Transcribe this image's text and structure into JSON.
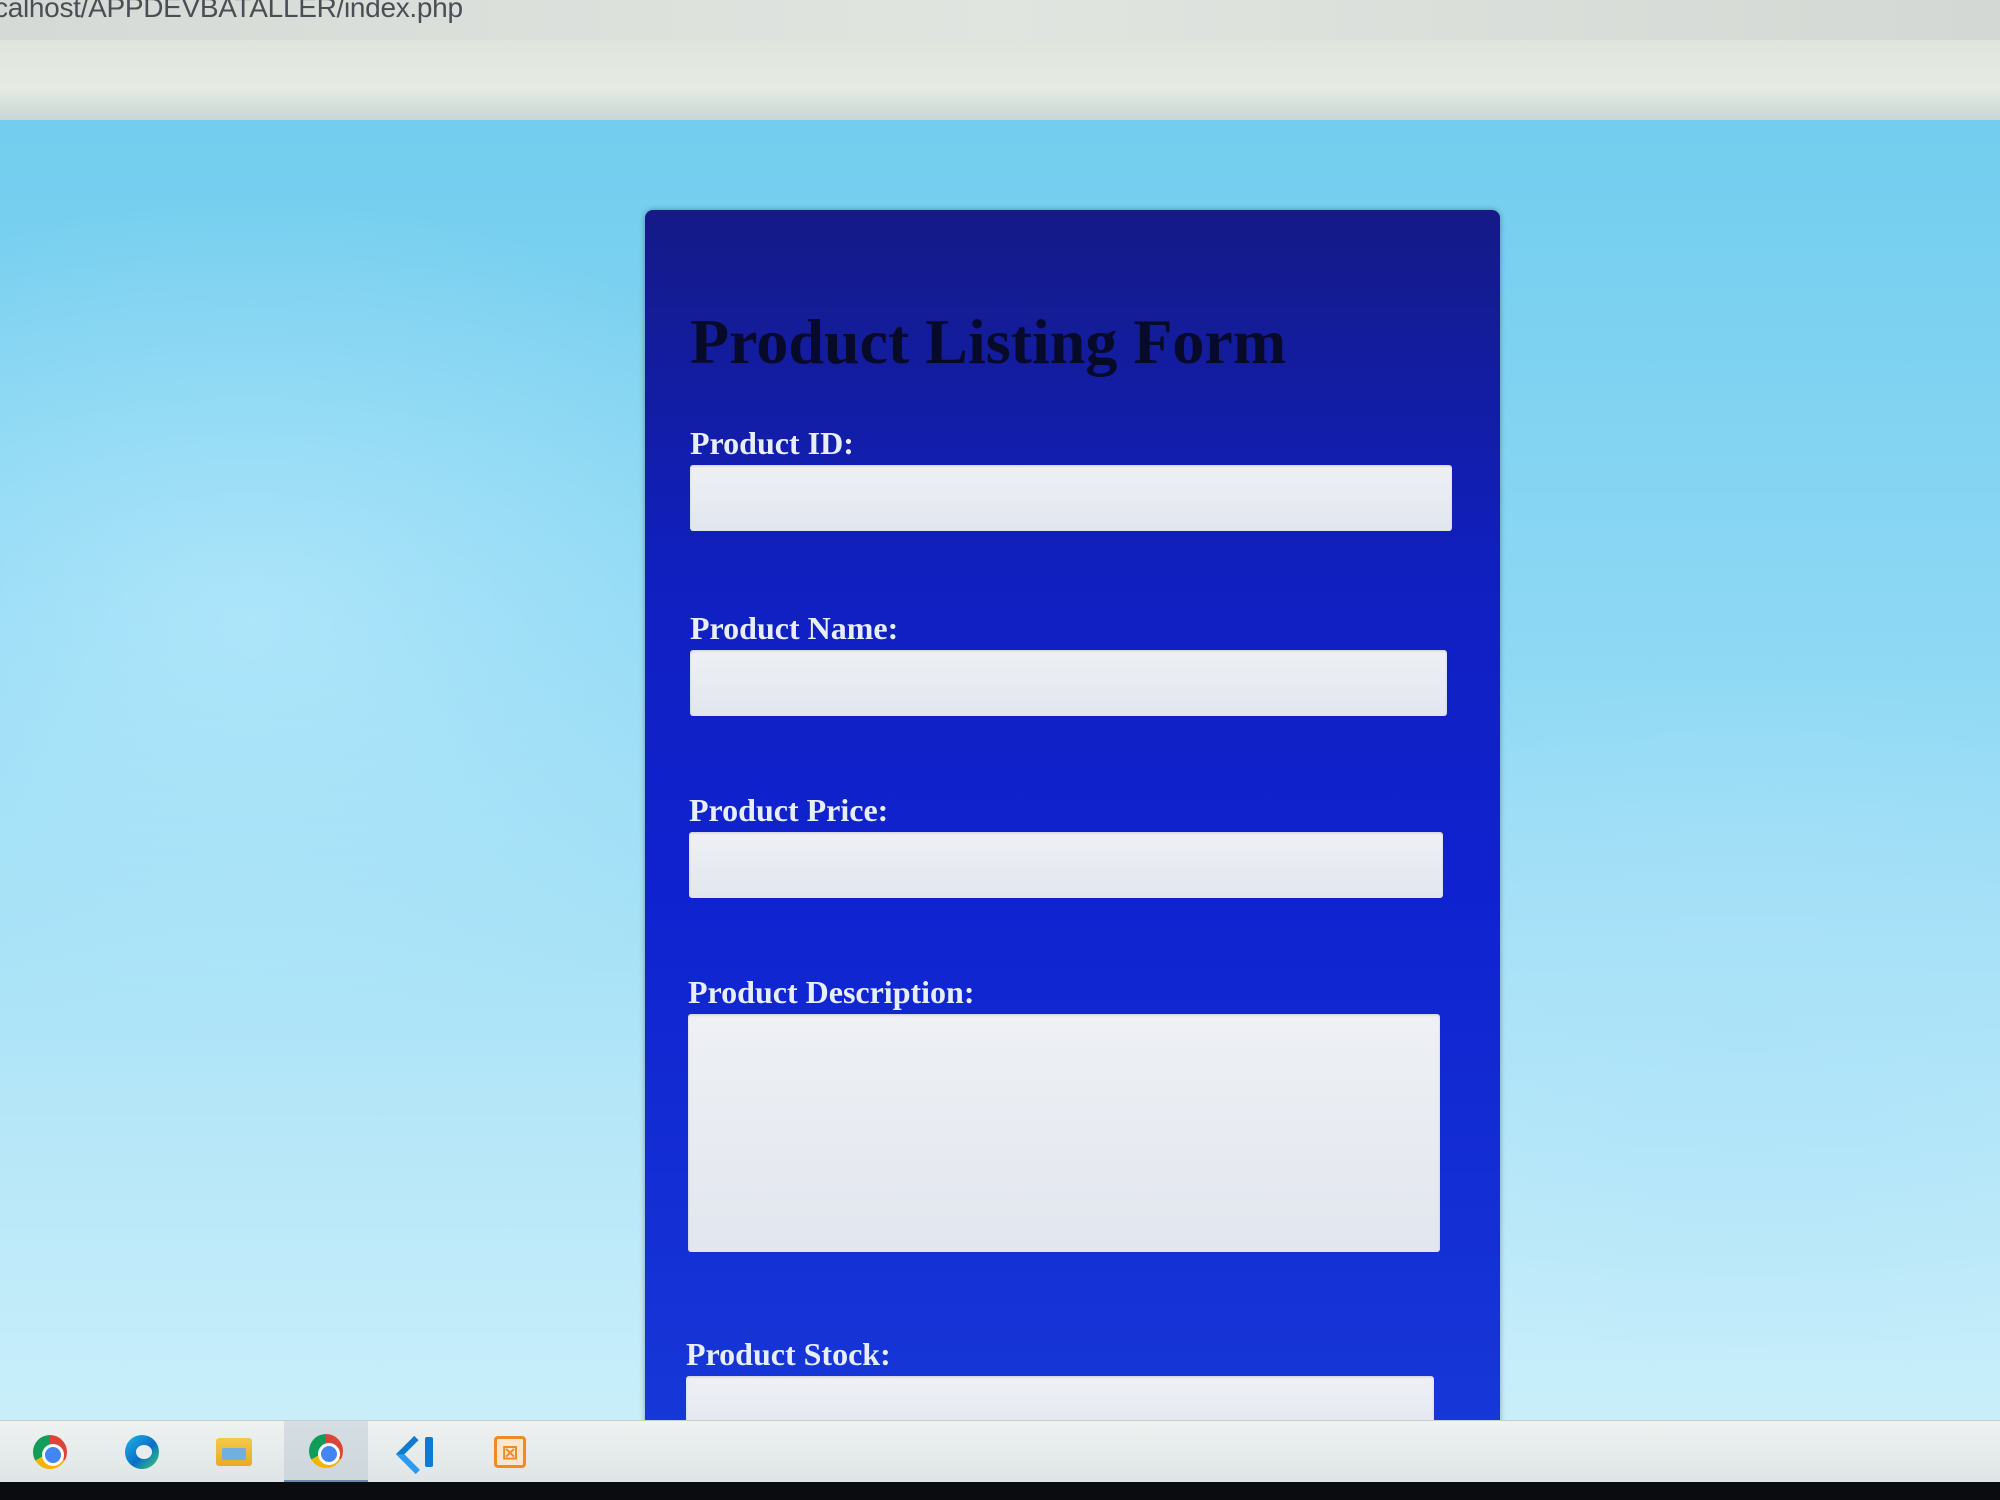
{
  "browser": {
    "url": "calhost/APPDEVBATALLER/index.php"
  },
  "form": {
    "title": "Product Listing Form",
    "fields": [
      {
        "label": "Product ID:",
        "value": ""
      },
      {
        "label": "Product Name:",
        "value": ""
      },
      {
        "label": "Product Price:",
        "value": ""
      },
      {
        "label": "Product Description:",
        "value": ""
      },
      {
        "label": "Product Stock:",
        "value": ""
      }
    ]
  },
  "taskbar": {
    "items": [
      {
        "icon": "chrome-icon"
      },
      {
        "icon": "edge-icon"
      },
      {
        "icon": "file-explorer-icon"
      },
      {
        "icon": "chrome-icon",
        "active": true
      },
      {
        "icon": "vscode-icon"
      },
      {
        "icon": "xampp-icon",
        "glyph": "⊠"
      }
    ]
  },
  "colors": {
    "page_background": "#8dd8f4",
    "form_background": "#1020c0",
    "label_text": "#e8eef8",
    "title_text": "#080a2a",
    "input_background": "#eef0f4"
  }
}
